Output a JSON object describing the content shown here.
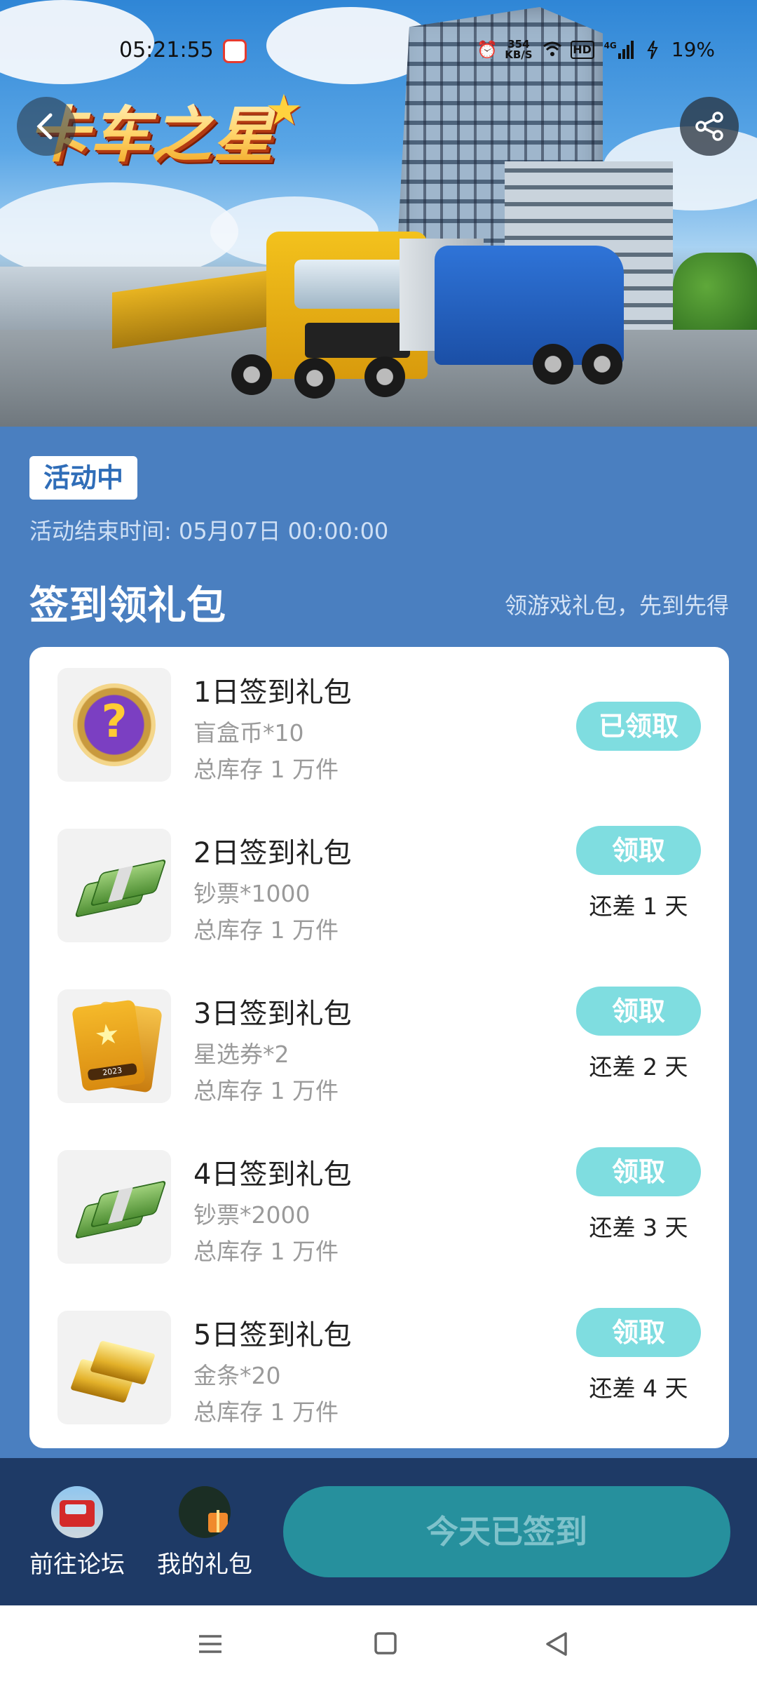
{
  "status_bar": {
    "time": "05:21:55",
    "net_speed_top": "354",
    "net_speed_bottom": "KB/S",
    "network": "4G",
    "battery": "19%"
  },
  "hero": {
    "logo_text": "卡车之星",
    "logo_star": "★"
  },
  "activity": {
    "status_tag": "活动中",
    "end_time": "活动结束时间: 05月07日 00:00:00"
  },
  "section": {
    "title": "签到领礼包",
    "subtitle": "领游戏礼包，先到先得"
  },
  "gifts": [
    {
      "title": "1日签到礼包",
      "item": "盲盒币*10",
      "stock": "总库存 1 万件",
      "button": "已领取",
      "remain": "",
      "icon": "coin-icon"
    },
    {
      "title": "2日签到礼包",
      "item": "钞票*1000",
      "stock": "总库存 1 万件",
      "button": "领取",
      "remain": "还差 1 天",
      "icon": "money-icon"
    },
    {
      "title": "3日签到礼包",
      "item": "星选券*2",
      "stock": "总库存 1 万件",
      "button": "领取",
      "remain": "还差 2 天",
      "icon": "ticket-icon"
    },
    {
      "title": "4日签到礼包",
      "item": "钞票*2000",
      "stock": "总库存 1 万件",
      "button": "领取",
      "remain": "还差 3 天",
      "icon": "money-icon"
    },
    {
      "title": "5日签到礼包",
      "item": "金条*20",
      "stock": "总库存 1 万件",
      "button": "领取",
      "remain": "还差 4 天",
      "icon": "gold-bar-icon"
    }
  ],
  "ticket_year": "2023",
  "bottom": {
    "forum_label": "前往论坛",
    "mygifts_label": "我的礼包",
    "signed_label": "今天已签到"
  },
  "colors": {
    "page_bg": "#4a7fc0",
    "button_bg": "#7fdde0",
    "bottom_bar": "#1e3a66",
    "signed_btn": "#26909d"
  }
}
